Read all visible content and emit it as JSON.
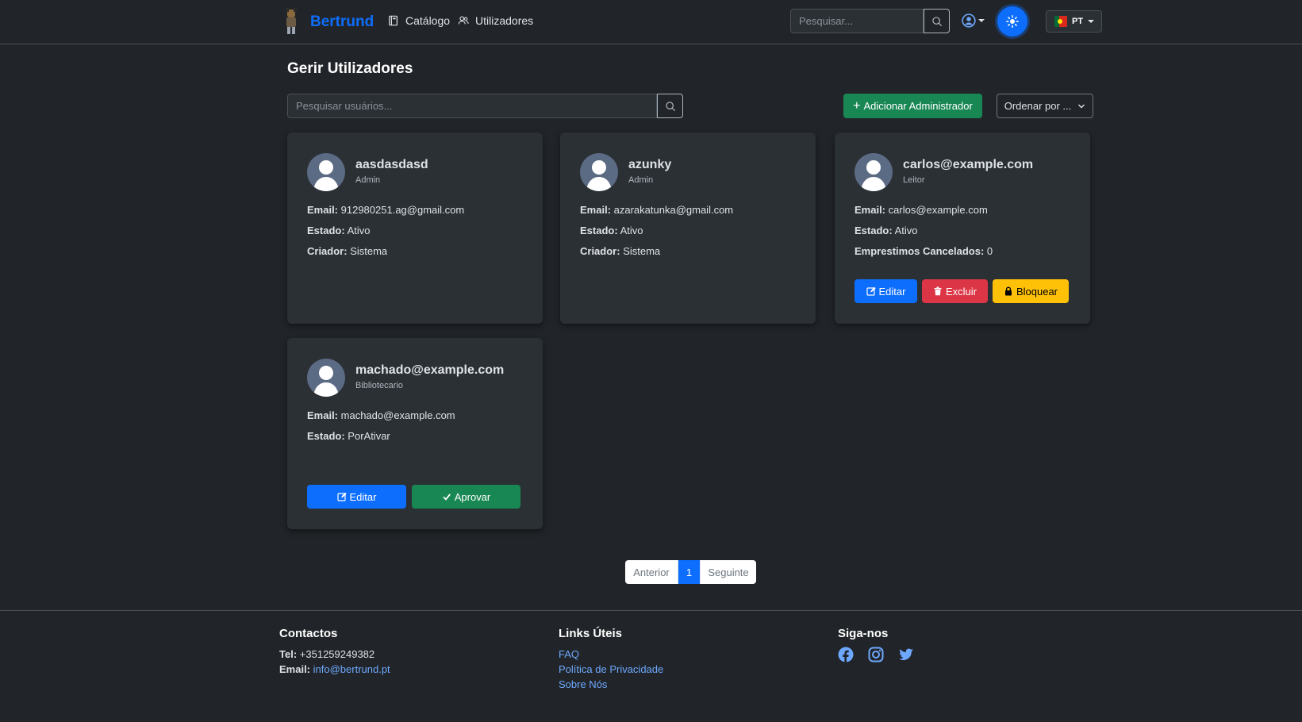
{
  "navbar": {
    "brand": "Bertrund",
    "links": [
      {
        "label": "Catálogo",
        "icon": "book-icon"
      },
      {
        "label": "Utilizadores",
        "icon": "users-icon"
      }
    ],
    "search_placeholder": "Pesquisar...",
    "language": "PT"
  },
  "main": {
    "title": "Gerir Utilizadores",
    "search_placeholder": "Pesquisar usuários...",
    "add_admin_label": "Adicionar Administrador",
    "sort_label": "Ordenar por ..."
  },
  "labels": {
    "email": "Email:",
    "status": "Estado:",
    "creator": "Criador:",
    "cancelled_loans": "Emprestimos Cancelados:",
    "edit": "Editar",
    "delete": "Excluir",
    "block": "Bloquear",
    "approve": "Aprovar"
  },
  "users": [
    {
      "name": "aasdasdasd",
      "role": "Admin",
      "email": "912980251.ag@gmail.com",
      "status": "Ativo",
      "creator": "Sistema"
    },
    {
      "name": "azunky",
      "role": "Admin",
      "email": "azarakatunka@gmail.com",
      "status": "Ativo",
      "creator": "Sistema"
    },
    {
      "name": "carlos@example.com",
      "role": "Leitor",
      "email": "carlos@example.com",
      "status": "Ativo",
      "cancelled_loans": "0"
    },
    {
      "name": "machado@example.com",
      "role": "Bibliotecario",
      "email": "machado@example.com",
      "status": "PorAtivar"
    }
  ],
  "pagination": {
    "prev": "Anterior",
    "current": "1",
    "next": "Seguinte"
  },
  "footer": {
    "contacts_title": "Contactos",
    "tel_label": "Tel:",
    "tel": "+351259249382",
    "email_label": "Email:",
    "email": "info@bertrund.pt",
    "links_title": "Links Úteis",
    "links": [
      "FAQ",
      "Política de Privacidade",
      "Sobre Nós"
    ],
    "social_title": "Siga-nos",
    "social": [
      "facebook-icon",
      "instagram-icon",
      "twitter-icon"
    ]
  },
  "colors": {
    "accent": "#0d6efd",
    "success": "#198754",
    "danger": "#dc3545",
    "warning": "#ffc107",
    "background": "#212529",
    "card": "#2b3035"
  }
}
